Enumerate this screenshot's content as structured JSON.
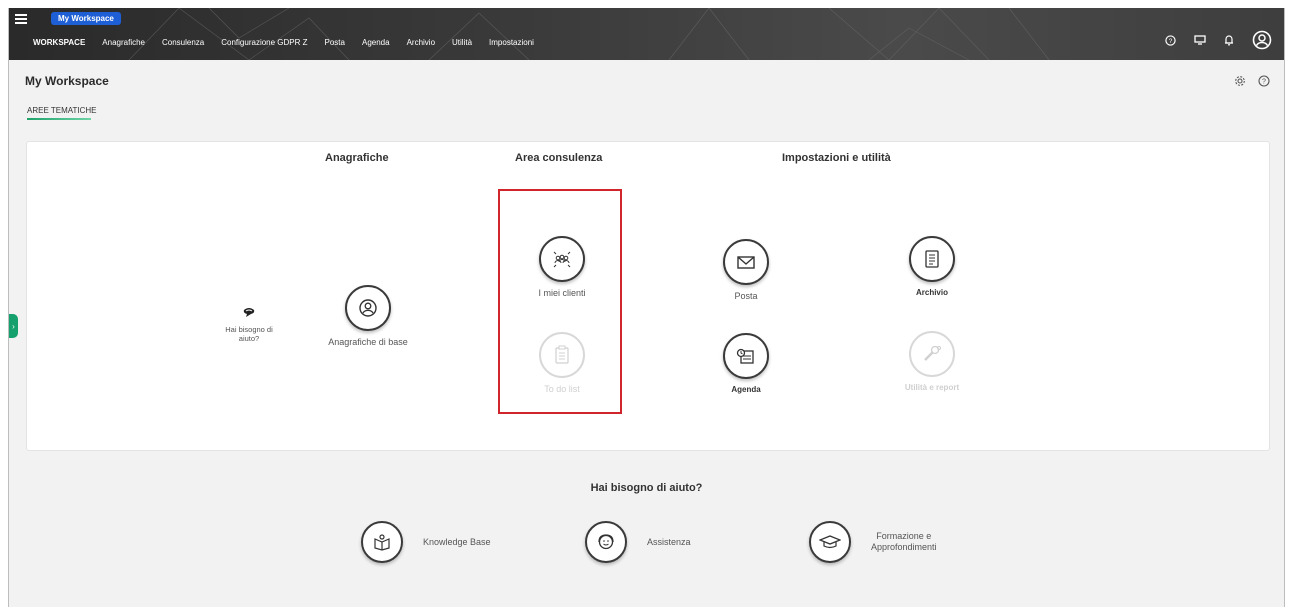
{
  "topbar": {
    "workspace_pill": "My Workspace",
    "nav": [
      "WORKSPACE",
      "Anagrafiche",
      "Consulenza",
      "Configurazione GDPR Z",
      "Posta",
      "Agenda",
      "Archivio",
      "Utilità",
      "Impostazioni"
    ],
    "icons": [
      "help-circle-icon",
      "monitor-icon",
      "bell-icon",
      "user-circle-icon"
    ]
  },
  "header": {
    "title": "My Workspace",
    "tab": "AREE TEMATICHE",
    "icons": [
      "settings-gear-icon",
      "help-circle-icon"
    ]
  },
  "card": {
    "col_anagrafiche": "Anagrafiche",
    "col_consulenza": "Area consulenza",
    "col_impostazioni": "Impostazioni e utilità",
    "help_small": "Hai bisogno di aiuto?",
    "tiles": {
      "anagrafiche_base": "Anagrafiche di base",
      "miei_clienti": "I miei clienti",
      "todo": "To do list",
      "posta": "Posta",
      "agenda": "Agenda",
      "archivio": "Archivio",
      "utilita": "Utilità e report"
    }
  },
  "help": {
    "title": "Hai bisogno di aiuto?",
    "knowledge": "Knowledge Base",
    "assistenza": "Assistenza",
    "formazione_1": "Formazione e",
    "formazione_2": "Approfondimenti"
  },
  "colors": {
    "accent_green": "#15a06d",
    "pill_blue": "#1f5fd6",
    "highlight_red": "#d0252b"
  }
}
